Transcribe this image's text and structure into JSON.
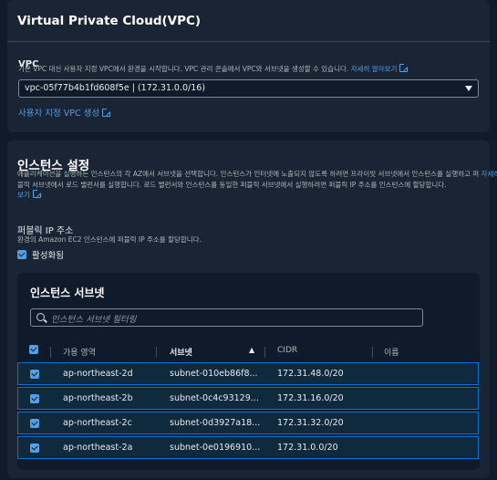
{
  "vpc_section": {
    "title": "Virtual Private Cloud(VPC)",
    "label": "VPC",
    "description": "기본 VPC 대신 사용자 지정 VPC에서 환경을 시작합니다. VPC 관리 콘솔에서 VPC와 서브넷을 생성할 수 있습니다.",
    "learn_more": "자세히 알아보기",
    "selected_vpc": "vpc-05f77b4b1fd608f5e | (172.31.0.0/16)",
    "create_link": "사용자 지정 VPC 생성"
  },
  "instance_section": {
    "title": "인스턴스 설정",
    "description_1": "애플리케이션을 실행하는 인스턴스의 각 AZ에서 서브넷을 선택합니다. 인스턴스가 인터넷에 노출되지 않도록 하려면 프라이빗 서브넷에서 인스턴스를 실행하고 퍼",
    "description_2": "블릭 서브넷에서 로드 밸런서를 실행합니다. 로드 밸런서와 인스턴스를 동일한 퍼블릭 서브넷에서 실행하려면 퍼블릭 IP 주소를 인스턴스에 할당합니다.",
    "learn_more_1": "자세히 알아",
    "learn_more_2": "보기",
    "public_ip_label": "퍼블릭 IP 주소",
    "public_ip_desc": "환경의 Amazon EC2 인스턴스에 퍼블릭 IP 주소를 할당합니다.",
    "activated_label": "활성화됨",
    "activated": true
  },
  "subnet_table": {
    "title": "인스턴스 서브넷",
    "filter_placeholder": "인스턴스 서브넷 필터링",
    "columns": [
      "가용 영역",
      "서브넷",
      "CIDR",
      "이름"
    ],
    "sort_indicator": "▲",
    "rows": [
      {
        "az": "ap-northeast-2d",
        "subnet": "subnet-010eb86f8...",
        "cidr": "172.31.48.0/20",
        "name": "",
        "checked": true
      },
      {
        "az": "ap-northeast-2b",
        "subnet": "subnet-0c4c93129...",
        "cidr": "172.31.16.0/20",
        "name": "",
        "checked": true
      },
      {
        "az": "ap-northeast-2c",
        "subnet": "subnet-0d3927a18...",
        "cidr": "172.31.32.0/20",
        "name": "",
        "checked": true
      },
      {
        "az": "ap-northeast-2a",
        "subnet": "subnet-0e0196910...",
        "cidr": "172.31.0.0/20",
        "name": "",
        "checked": true
      }
    ]
  },
  "colors": {
    "accent": "#539fe5",
    "panel": "#192534",
    "background": "#0f1b2a",
    "row_selected": "#0f2a3d"
  },
  "icons": [
    "external-link-icon",
    "chevron-down-icon",
    "search-icon",
    "checkbox-icon",
    "sort-ascending-icon"
  ]
}
